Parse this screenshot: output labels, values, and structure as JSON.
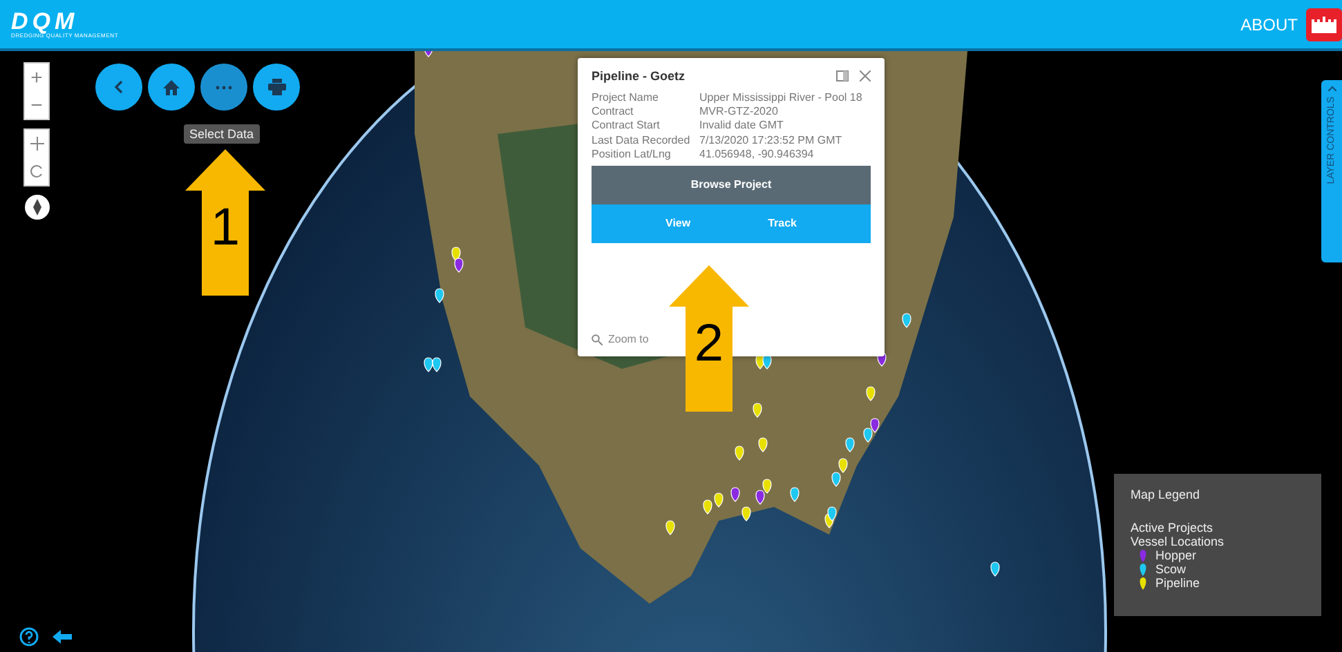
{
  "header": {
    "logo_text": "DQM",
    "logo_subtitle": "DREDGING QUALITY MANAGEMENT",
    "about": "ABOUT"
  },
  "map_controls": {
    "zoom_in": "+",
    "zoom_out": "−"
  },
  "toolbar": {
    "buttons": [
      {
        "kind": "back",
        "active": false
      },
      {
        "kind": "home",
        "active": false
      },
      {
        "kind": "more",
        "active": true
      },
      {
        "kind": "print",
        "active": false
      }
    ],
    "tooltip": "Select Data"
  },
  "popup": {
    "title": "Pipeline - Goetz",
    "fields": [
      {
        "label": "Project Name",
        "value": "Upper Mississippi River - Pool 18"
      },
      {
        "label": "Contract",
        "value": "MVR-GTZ-2020"
      },
      {
        "label": "Contract Start",
        "value": "Invalid date GMT"
      },
      {
        "label": "Last Data Recorded",
        "value": "7/13/2020 17:23:52 PM GMT"
      },
      {
        "label": "Position Lat/Lng",
        "value": "41.056948, -90.946394"
      }
    ],
    "buttons": [
      {
        "label": "Browse Project",
        "kind": "dark"
      },
      {
        "label_parts": [
          "View",
          "Track"
        ],
        "kind": "light"
      }
    ],
    "zoom_to": "Zoom to"
  },
  "layer_controls": {
    "label": "LAYER CONTROLS"
  },
  "legend": {
    "title": "Map Legend",
    "section_1": "Active Projects",
    "section_2": "Vessel Locations",
    "items": [
      {
        "label": "Hopper",
        "color": "#8a2be2"
      },
      {
        "label": "Scow",
        "color": "#1ec8f0"
      },
      {
        "label": "Pipeline",
        "color": "#e8e000"
      }
    ]
  },
  "annotations": [
    {
      "number": "1"
    },
    {
      "number": "2"
    }
  ]
}
